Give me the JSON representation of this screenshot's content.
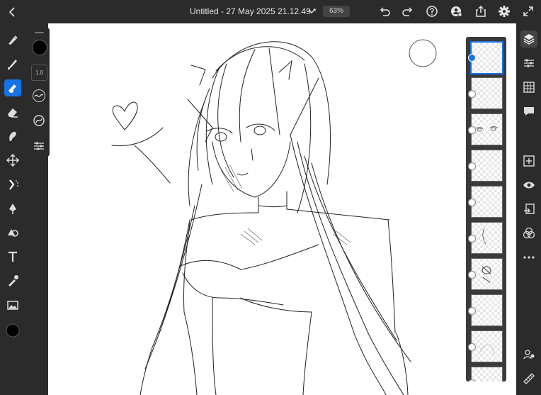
{
  "document": {
    "title": "Untitled - 27 May 2025 21.12.49 *",
    "zoom": "63%"
  },
  "toolbar": {
    "icons": [
      "back-icon",
      "chevron-down-icon",
      "undo-icon",
      "redo-icon",
      "help-icon",
      "share-user-icon",
      "export-icon",
      "gear-icon",
      "expand-icon"
    ]
  },
  "brush": {
    "size": "1.0",
    "color": "#000000"
  },
  "colors": {
    "accent": "#1473e6",
    "panel": "#2b2b2b",
    "canvas": "#ffffff"
  },
  "left_tools": [
    "paint-brush-icon",
    "pixel-brush-icon",
    "active-brush-icon",
    "eraser-icon",
    "smudge-icon",
    "move-icon",
    "selection-icon",
    "pen-icon",
    "shape-icon",
    "text-icon",
    "eyedropper-icon",
    "image-icon",
    "color-swatch"
  ],
  "right_tools": [
    "layers-icon",
    "properties-icon",
    "grid-icon",
    "comments-icon",
    "add-layer-icon",
    "visibility-icon",
    "import-icon",
    "blend-icon",
    "more-icon",
    "users-icon",
    "ruler-icon"
  ],
  "layers": {
    "count": 10,
    "selected_index": 0
  }
}
